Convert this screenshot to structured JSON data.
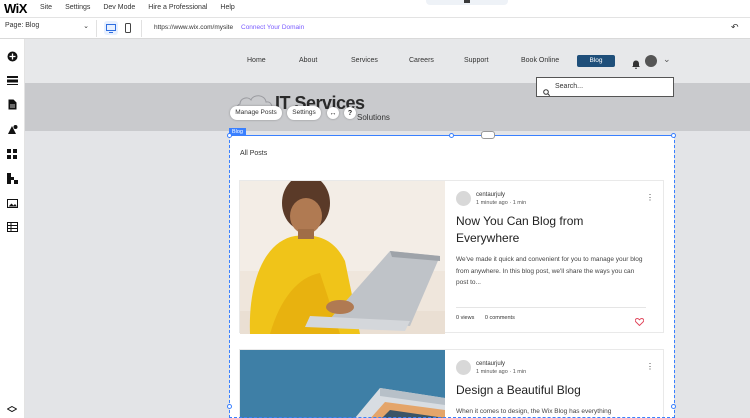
{
  "app": {
    "logo": "WiX"
  },
  "menu": [
    "Site",
    "Settings",
    "Dev Mode",
    "Hire a Professional",
    "Help"
  ],
  "toolbar": {
    "page_label": "Page: Blog",
    "url": "https://www.wix.com/mysite",
    "connect_domain": "Connect Your Domain"
  },
  "site_nav": {
    "items": [
      "Home",
      "About",
      "Services",
      "Careers",
      "Support",
      "Book Online"
    ],
    "active": "Blog"
  },
  "search": {
    "placeholder": "Search..."
  },
  "hero": {
    "title": "IT Services",
    "subtitle": "Solutions"
  },
  "blog_toolbar": {
    "manage_posts": "Manage Posts",
    "settings": "Settings"
  },
  "blog_tag": "Blog",
  "blog": {
    "heading": "All Posts",
    "posts": [
      {
        "author": "centaurjuly",
        "time": "1 minute ago",
        "read": "1 min",
        "title": "Now You Can Blog from Everywhere",
        "excerpt": "We've made it quick and convenient for you to manage your blog from anywhere. In this blog post, we'll share the ways you can post to...",
        "views": "0 views",
        "comments": "0 comments"
      },
      {
        "author": "centaurjuly",
        "time": "1 minute ago",
        "read": "1 min",
        "title": "Design a Beautiful Blog",
        "excerpt": "When it comes to design, the Wix Blog has everything"
      }
    ]
  },
  "colors": {
    "accent": "#3a80ff",
    "nav_active": "#1f4f7a",
    "link": "#7a5cff"
  }
}
